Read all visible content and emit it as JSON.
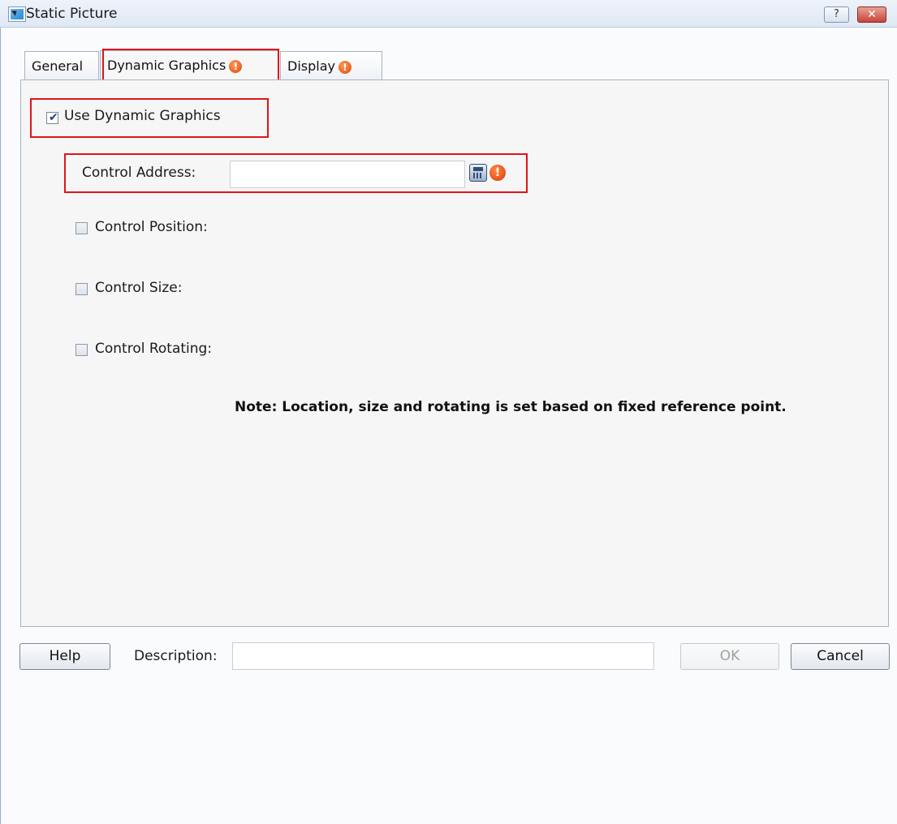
{
  "window": {
    "title": "Static Picture",
    "help_glyph": "?",
    "close_glyph": "✕"
  },
  "tabs": [
    {
      "label": "General",
      "warning": false
    },
    {
      "label": "Dynamic Graphics",
      "warning": true
    },
    {
      "label": "Display",
      "warning": true
    }
  ],
  "active_tab": "Dynamic Graphics",
  "options": {
    "use_dynamic_graphics": {
      "label": "Use Dynamic Graphics",
      "checked": true
    },
    "control_address": {
      "label": "Control Address:",
      "value": ""
    },
    "control_position": {
      "label": "Control Position:",
      "checked": false
    },
    "control_size": {
      "label": "Control Size:",
      "checked": false
    },
    "control_rotating": {
      "label": "Control Rotating:",
      "checked": false
    }
  },
  "note": "Note: Location, size and rotating is set based on fixed reference point.",
  "footer": {
    "help_label": "Help",
    "description_label": "Description:",
    "description_value": "",
    "ok_label": "OK",
    "cancel_label": "Cancel"
  },
  "warning_glyph": "!",
  "colors": {
    "highlight": "#e0141a",
    "warning": "#e0450c",
    "checkmark": "#1e3e8f"
  }
}
